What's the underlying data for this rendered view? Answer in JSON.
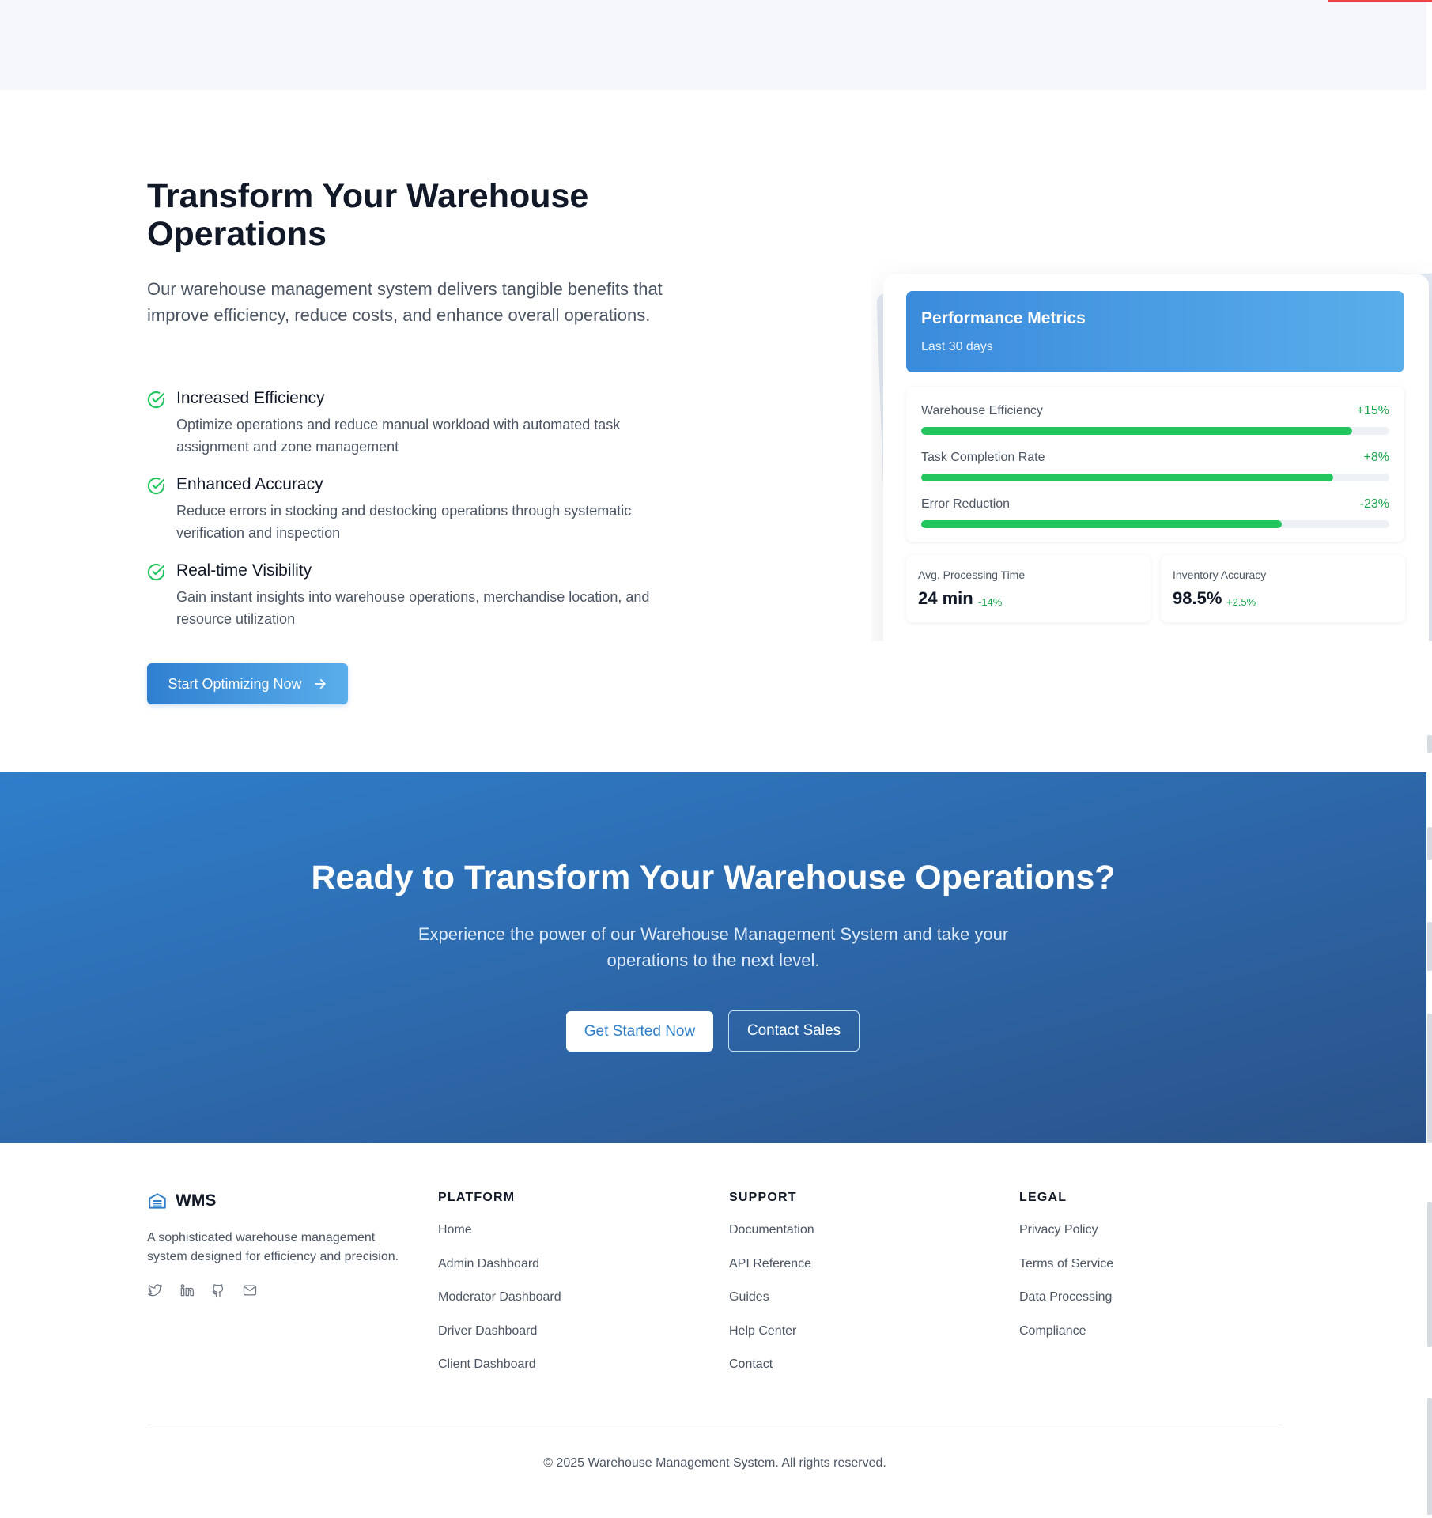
{
  "benefits": {
    "title": "Transform Your Warehouse Operations",
    "intro": "Our warehouse management system delivers tangible benefits that improve efficiency, reduce costs, and enhance overall operations.",
    "features": [
      {
        "title": "Increased Efficiency",
        "description": "Optimize operations and reduce manual workload with automated task assignment and zone management",
        "icon": "check-circle-icon"
      },
      {
        "title": "Enhanced Accuracy",
        "description": "Reduce errors in stocking and destocking operations through systematic verification and inspection",
        "icon": "check-circle-icon"
      },
      {
        "title": "Real-time Visibility",
        "description": "Gain instant insights into warehouse operations, merchandise location, and resource utilization",
        "icon": "check-circle-icon"
      }
    ],
    "cta_label": "Start Optimizing Now",
    "cta_icon": "arrow-right-icon"
  },
  "metrics_card": {
    "title": "Performance Metrics",
    "subtitle": "Last 30 days",
    "bars": [
      {
        "label": "Warehouse Efficiency",
        "delta": "+15%",
        "progress": 0.92
      },
      {
        "label": "Task Completion Rate",
        "delta": "+8%",
        "progress": 0.88
      },
      {
        "label": "Error Reduction",
        "delta": "-23%",
        "progress": 0.77
      }
    ],
    "stats": [
      {
        "label": "Avg. Processing Time",
        "value": "24 min",
        "delta": "-14%"
      },
      {
        "label": "Inventory Accuracy",
        "value": "98.5%",
        "delta": "+2.5%"
      }
    ]
  },
  "cta_band": {
    "title": "Ready to Transform Your Warehouse Operations?",
    "subtitle": "Experience the power of our Warehouse Management System and take your operations to the next level.",
    "primary_label": "Get Started Now",
    "secondary_label": "Contact Sales"
  },
  "footer": {
    "brand_name": "WMS",
    "brand_icon": "warehouse-icon",
    "brand_description": "A sophisticated warehouse management system designed for efficiency and precision.",
    "socials": [
      "twitter-icon",
      "linkedin-icon",
      "github-icon",
      "mail-icon"
    ],
    "columns": [
      {
        "heading": "PLATFORM",
        "links": [
          "Home",
          "Admin Dashboard",
          "Moderator Dashboard",
          "Driver Dashboard",
          "Client Dashboard"
        ]
      },
      {
        "heading": "SUPPORT",
        "links": [
          "Documentation",
          "API Reference",
          "Guides",
          "Help Center",
          "Contact"
        ]
      },
      {
        "heading": "LEGAL",
        "links": [
          "Privacy Policy",
          "Terms of Service",
          "Data Processing",
          "Compliance"
        ]
      }
    ],
    "copyright": "© 2025 Warehouse Management System. All rights reserved."
  },
  "colors": {
    "accent": "#2f7ecb",
    "success": "#22c55e",
    "cta_band_dark": "#2a5289"
  }
}
